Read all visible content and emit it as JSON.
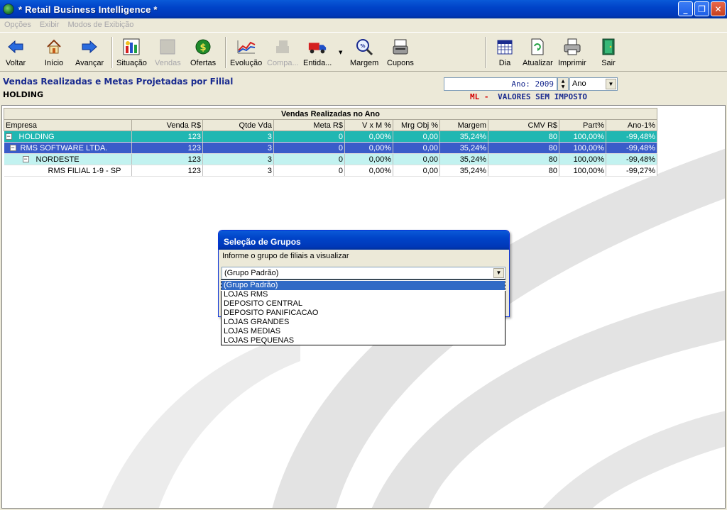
{
  "window": {
    "title": "* Retail Business Intelligence *"
  },
  "menu": [
    "Opções",
    "Exibir",
    "Modos de Exibição"
  ],
  "toolbar": {
    "voltar": "Voltar",
    "inicio": "Início",
    "avancar": "Avançar",
    "situacao": "Situação",
    "vendas": "Vendas",
    "ofertas": "Ofertas",
    "evolucao": "Evolução",
    "compras": "Compa...",
    "entidades": "Entida...",
    "margem": "Margem",
    "cupons": "Cupons",
    "dia": "Dia",
    "atualizar": "Atualizar",
    "imprimir": "Imprimir",
    "sair": "Sair"
  },
  "header": {
    "title": "Vendas Realizadas e Metas Projetadas por Filial",
    "subtitle": "HOLDING",
    "year_value": "Ano: 2009",
    "period_value": "Ano",
    "ml_label": "ML -",
    "valores_label": "VALORES SEM IMPOSTO"
  },
  "grid": {
    "group_header": "Vendas Realizadas no Ano",
    "columns": [
      "Empresa",
      "Venda R$",
      "Qtde Vda",
      "Meta R$",
      "V x M %",
      "Mrg Obj %",
      "Margem",
      "CMV R$",
      "Part%",
      "Ano-1%"
    ],
    "rows": [
      [
        "HOLDING",
        "123",
        "3",
        "0",
        "0,00%",
        "0,00",
        "35,24%",
        "80",
        "100,00%",
        "-99,48%"
      ],
      [
        "RMS SOFTWARE LTDA.",
        "123",
        "3",
        "0",
        "0,00%",
        "0,00",
        "35,24%",
        "80",
        "100,00%",
        "-99,48%"
      ],
      [
        "NORDESTE",
        "123",
        "3",
        "0",
        "0,00%",
        "0,00",
        "35,24%",
        "80",
        "100,00%",
        "-99,48%"
      ],
      [
        "RMS FILIAL 1-9 - SP",
        "123",
        "3",
        "0",
        "0,00%",
        "0,00",
        "35,24%",
        "80",
        "100,00%",
        "-99,27%"
      ]
    ]
  },
  "dialog": {
    "title": "Seleção de Grupos",
    "prompt": "Informe o grupo de filiais a visualizar",
    "selected": "(Grupo Padrão)",
    "options": [
      "(Grupo Padrão)",
      "LOJAS RMS",
      "DEPOSITO CENTRAL",
      "DEPOSITO PANIFICACAO",
      "LOJAS GRANDES",
      "LOJAS MEDIAS",
      "LOJAS PEQUENAS"
    ]
  },
  "colors": {
    "titlebar": "#0043c8",
    "row_holding": "#21b7b2",
    "row_company": "#3a5cc9",
    "row_region": "#c2f2f0",
    "ml_red": "#d40000",
    "navy": "#1a2b8f"
  }
}
